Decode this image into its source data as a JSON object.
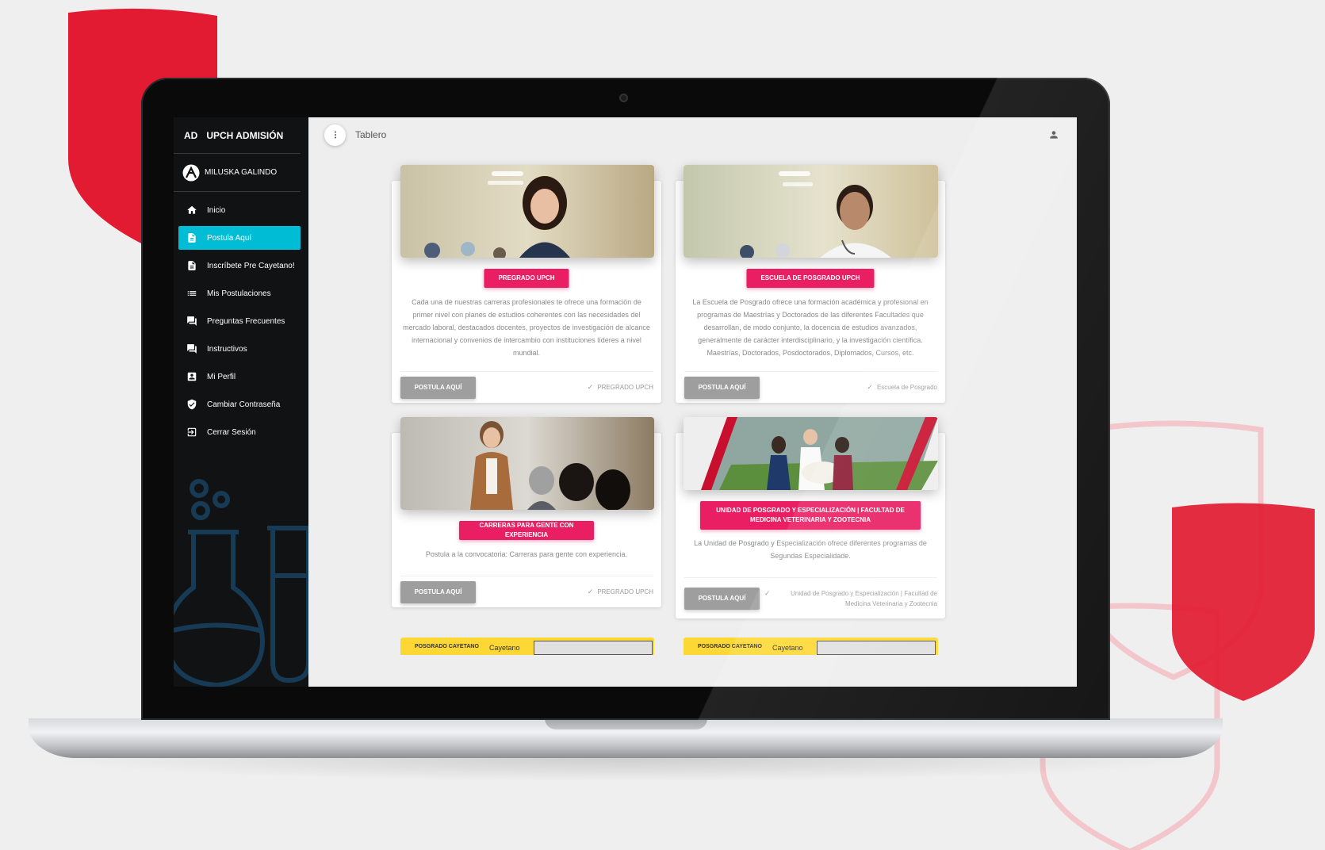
{
  "sidebar": {
    "brand_short": "AD",
    "brand_name": "UPCH ADMISIÓN",
    "user_name": "MILUSKA GALINDO",
    "items": [
      {
        "label": "Inicio",
        "icon": "home-icon",
        "active": false
      },
      {
        "label": "Postula Aquí",
        "icon": "document-icon",
        "active": true
      },
      {
        "label": "Inscríbete Pre Cayetano!",
        "icon": "document-icon",
        "active": false
      },
      {
        "label": "Mis Postulaciones",
        "icon": "list-icon",
        "active": false
      },
      {
        "label": "Preguntas Frecuentes",
        "icon": "chat-icon",
        "active": false
      },
      {
        "label": "Instructivos",
        "icon": "chat-icon",
        "active": false
      },
      {
        "label": "Mi Perfil",
        "icon": "profile-icon",
        "active": false
      },
      {
        "label": "Cambiar Contraseña",
        "icon": "shield-check-icon",
        "active": false
      },
      {
        "label": "Cerrar Sesión",
        "icon": "logout-icon",
        "active": false
      }
    ]
  },
  "header": {
    "title": "Tablero"
  },
  "cards": [
    {
      "badge": "PREGRADO UPCH",
      "description": "Cada una de nuestras carreras profesionales te ofrece una formación de primer nivel con planes de estudios coherentes con las necesidades del mercado laboral, destacados docentes, proyectos de investigación de alcance internacional y convenios de intercambio con instituciones líderes a nivel mundial.",
      "button": "POSTULA AQUÍ",
      "tag": "PREGRADO UPCH"
    },
    {
      "badge": "ESCUELA DE POSGRADO UPCH",
      "description": "La Escuela de Posgrado ofrece una formación académica y profesional en programas de Maestrías y Doctorados de las diferentes Facultades que desarrollan, de modo conjunto, la docencia de estudios avanzados, generalmente de carácter interdisciplinario, y la investigación científica. Maestrías, Doctorados, Posdoctorados, Diplomados, Cursos, etc.",
      "button": "POSTULA AQUÍ",
      "tag": "Escuela de Posgrado"
    },
    {
      "badge": "CARRERAS PARA GENTE CON EXPERIENCIA",
      "description": "Postula a la convocatoria: Carreras para gente con experiencia.",
      "button": "POSTULA AQUÍ",
      "tag": "PREGRADO UPCH"
    },
    {
      "badge": "UNIDAD DE POSGRADO Y ESPECIALIZACIÓN | FACULTAD DE MEDICINA VETERINARIA Y ZOOTECNIA",
      "description": "La Unidad de Posgrado y Especialización ofrece diferentes programas de Segundas Especialidade.",
      "button": "POSTULA AQUÍ",
      "tag": "Unidad de Posgrado y Especialización | Facultad de Medicina Veterinaria y Zootecnia"
    }
  ],
  "banners": [
    {
      "logo": "POSGRADO CAYETANO",
      "brand": "Cayetano"
    },
    {
      "logo": "POSGRADO CAYETANO",
      "brand": "Cayetano"
    }
  ],
  "colors": {
    "accent": "#00bcd4",
    "badge": "#e91e63",
    "sidebar": "#111214",
    "brand_red": "#e31b32"
  }
}
